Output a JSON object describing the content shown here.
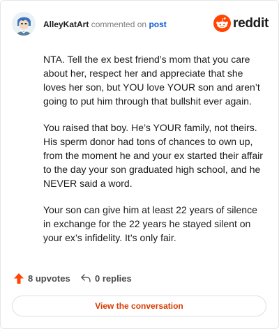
{
  "header": {
    "author": "AlleyKatArt",
    "commented_text": "commented on",
    "post_link": "post",
    "brand": "reddit"
  },
  "comment": {
    "paragraphs": [
      "NTA. Tell the ex best friend’s mom that you care about her, respect her and appreciate that she loves her son, but YOU love YOUR son and aren’t going to put him through that bullshit ever again.",
      "You raised that boy. He’s YOUR family, not theirs. His sperm donor had tons of chances to own up, from the moment he and your ex started their affair to the day your son graduated high school, and he NEVER said a word.",
      "Your son can give him at least 22 years of silence in exchange for the 22 years he stayed silent on your ex’s infidelity. It’s only fair."
    ]
  },
  "actions": {
    "upvotes": "8 upvotes",
    "replies": "0 replies",
    "upvote_icon": "arrow-up-icon",
    "reply_icon": "reply-arrow-icon"
  },
  "cta": {
    "label": "View the conversation"
  },
  "colors": {
    "accent": "#d93a00",
    "brand": "#ff4500",
    "link": "#0b5bd3",
    "border": "#e4e6e8"
  }
}
